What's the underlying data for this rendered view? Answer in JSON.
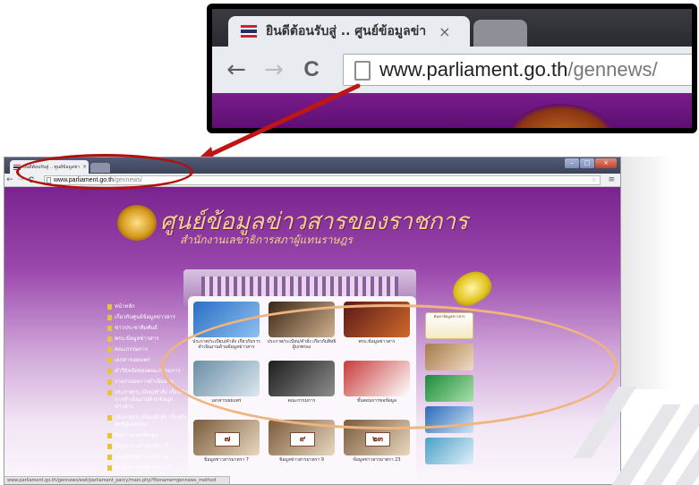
{
  "zoom": {
    "tab_title": "ยินดีต้อนรับสู่ .. ศูนย์ข้อมูลข่า",
    "close_glyph": "×",
    "url_host": "www.parliament.go.th",
    "url_path": "/gennews/"
  },
  "browser": {
    "tab_title": "ยินดีต้อนรับสู่ .. ศูนย์ข้อมูลข่า",
    "close_glyph": "×",
    "url_host": "www.parliament.go.th",
    "url_path": "/gennews/",
    "status_text": "www.parliament.go.th/gennews/ewt/parliament_parcy/main.php?filename=gennews_method"
  },
  "site": {
    "title": "ศูนย์ข้อมูลข่าวสารของราชการ",
    "subtitle": "สำนักงานเลขาธิการสภาผู้แทนราษฎร"
  },
  "sidebar": [
    "หน้าหลัก",
    "เกี่ยวกับศูนย์ข้อมูลข่าวสาร",
    "ข่าวประชาสัมพันธ์",
    "พรบ.ข้อมูลข่าวสาร",
    "คณะกรรมการ",
    "เอกสารเผยแพร่",
    "คำวินิจฉัยของคณะกรรมการ",
    "รายงานผลการดำเนินงาน",
    "ประกาศ/ระเบียบ/คำสั่ง เกี่ยวกับการดำเนินงานด้านข้อมูลข่าวสาร",
    "ประกาศ/ระเบียบ/คำสั่ง เกี่ยวกับสิทธิผู้บกพร่อง",
    "ลิงค์ภายนอกข้อมูล",
    "ข้อมูลข่าวสารมาตรา 7",
    "ข้อมูลข่าวสารมาตรา 9",
    "ข้อมูลข่าวสารมาตรา 23"
  ],
  "cards": [
    {
      "caption": "ประกาศ/ระเบียบ/คำสั่ง เกี่ยวกับการดำเนินงานด้านข้อมูลข่าวสาร"
    },
    {
      "caption": "ประกาศ/ระเบียบ/คำสั่ง เกี่ยวกับสิทธิผู้บกพร่อง"
    },
    {
      "caption": "พรบ.ข้อมูลข่าวสาร"
    },
    {
      "caption": "เอกสารเผยแพร่"
    },
    {
      "caption": "คณะกรรมการ"
    },
    {
      "caption": "ขั้นตอนการขอข้อมูล"
    },
    {
      "caption": "ข้อมูลข่าวสารมาตรา 7",
      "tag": "๗"
    },
    {
      "caption": "ข้อมูลข่าวสารมาตรา 9",
      "tag": "๙"
    },
    {
      "caption": "ข้อมูลข่าวสารมาตรา 23",
      "tag": "๒๓"
    }
  ],
  "right_box_label": "ค้นหาข้อมูลข่าวสาร",
  "colors": {
    "site_purple": "#7a238f",
    "annotation_red": "#b01010",
    "annotation_orange": "#f0b47e"
  }
}
